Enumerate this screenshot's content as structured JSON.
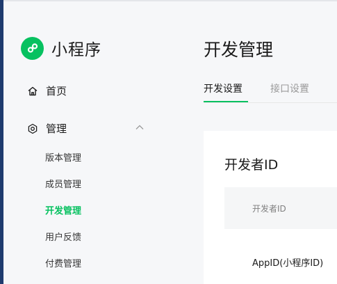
{
  "sidebar": {
    "app_name": "小程序",
    "nav": {
      "home_label": "首页",
      "manage_label": "管理",
      "manage_expanded": true
    },
    "sub_items": [
      {
        "label": "版本管理",
        "active": false
      },
      {
        "label": "成员管理",
        "active": false
      },
      {
        "label": "开发管理",
        "active": true
      },
      {
        "label": "用户反馈",
        "active": false
      },
      {
        "label": "付费管理",
        "active": false
      }
    ]
  },
  "main": {
    "page_title": "开发管理",
    "tabs": [
      {
        "label": "开发设置",
        "active": true
      },
      {
        "label": "接口设置",
        "active": false
      }
    ],
    "card": {
      "title": "开发者ID",
      "table": {
        "header": "开发者ID",
        "row_label": "AppID(小程序ID)"
      }
    }
  },
  "colors": {
    "accent": "#07c160",
    "left_bar": "#1f3b6e",
    "background": "#f6f7f9"
  },
  "icons": {
    "logo": "miniprogram-logo-icon",
    "home": "home-icon",
    "manage": "manage-icon",
    "chevron": "chevron-up-icon"
  }
}
